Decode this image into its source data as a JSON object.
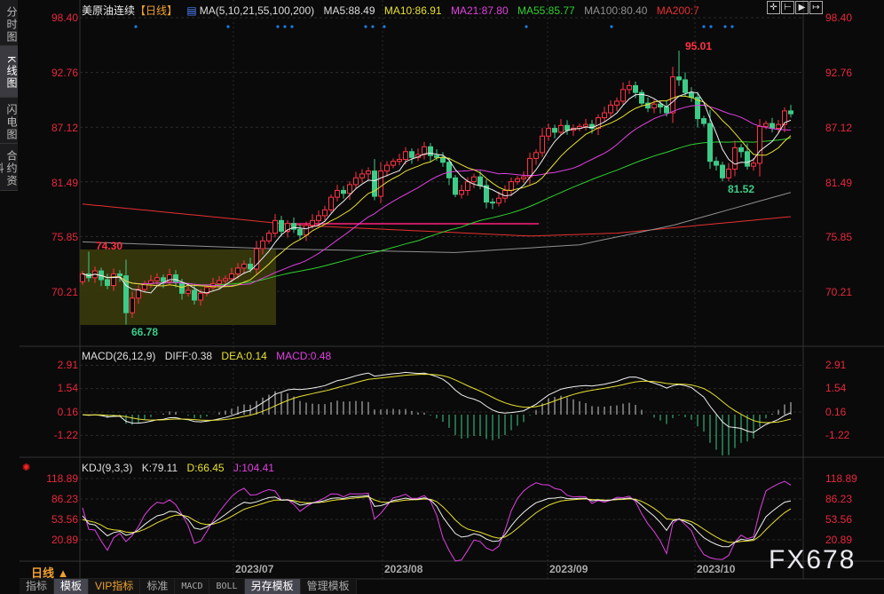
{
  "sidebar": {
    "items": [
      {
        "label": "分时图",
        "selected": false
      },
      {
        "label": "K线图",
        "selected": true
      },
      {
        "label": "闪电图",
        "selected": false
      },
      {
        "label": "合约资料",
        "selected": false
      }
    ]
  },
  "header": {
    "title": "美原油连续",
    "period_tag": "【日线】",
    "ma_params": "MA(5,10,21,55,100,200)",
    "ma5": "MA5:88.49",
    "ma10": "MA10:86.91",
    "ma21": "MA21:87.80",
    "ma55": "MA55:85.77",
    "ma100": "MA100:80.40",
    "ma200": "MA200:7"
  },
  "toolbar": {
    "icons": [
      "crosshair-icon",
      "zoom-range-icon",
      "play-forward-icon",
      "move-right-icon"
    ]
  },
  "colors": {
    "up": "#ff3344",
    "down": "#3dcc88",
    "ma5": "#f0f0f0",
    "ma10": "#e8e030",
    "ma21": "#e040e0",
    "ma55": "#30d030",
    "ma100": "#909090",
    "ma200": "#e83030",
    "hline": "#ff2080",
    "box": "#3a3a0c"
  },
  "main_axis": {
    "labels": [
      "98.40",
      "92.76",
      "87.12",
      "81.49",
      "75.85",
      "70.21"
    ],
    "values": [
      98.4,
      92.76,
      87.12,
      81.49,
      75.85,
      70.21
    ]
  },
  "annotations": {
    "high_left": "74.30",
    "low_left": "66.78",
    "high_right": "95.01",
    "low_right": "81.52"
  },
  "macd": {
    "title": "MACD(26,12,9)",
    "diff": "DIFF:0.38",
    "dea": "DEA:0.14",
    "macd": "MACD:0.48",
    "axis_labels": [
      "2.91",
      "1.54",
      "0.16",
      "-1.22"
    ],
    "axis_values": [
      2.91,
      1.54,
      0.16,
      -1.22
    ]
  },
  "kdj": {
    "title": "KDJ(9,3,3)",
    "k": "K:79.11",
    "d": "D:66.45",
    "j": "J:104.41",
    "axis_labels": [
      "118.89",
      "86.23",
      "53.56",
      "20.89"
    ],
    "axis_values": [
      118.89,
      86.23,
      53.56,
      20.89
    ]
  },
  "dates": [
    "2023/07",
    "2023/08",
    "2023/09",
    "2023/10"
  ],
  "period": "日线 ▲",
  "tabs": [
    {
      "label": "指标"
    },
    {
      "label": "模板",
      "selected": true
    },
    {
      "label": "VIP指标",
      "vip": true
    },
    {
      "label": "标准"
    },
    {
      "label": "MACD"
    },
    {
      "label": "BOLL"
    },
    {
      "label": "另存模板",
      "selected": true
    },
    {
      "label": "管理模板"
    }
  ],
  "watermark": "FX678",
  "chart_data": {
    "type": "candlestick",
    "closes": [
      72.0,
      71.6,
      72.3,
      71.4,
      70.8,
      72.0,
      71.8,
      68.0,
      69.5,
      70.4,
      71.0,
      71.3,
      71.6,
      71.2,
      71.9,
      71.1,
      70.0,
      70.3,
      69.3,
      70.0,
      70.6,
      71.0,
      71.3,
      71.5,
      72.0,
      72.6,
      73.0,
      72.5,
      74.6,
      75.4,
      76.2,
      77.5,
      76.4,
      77.2,
      76.6,
      76.0,
      77.0,
      77.5,
      78.0,
      78.6,
      79.9,
      80.6,
      80.3,
      81.2,
      81.9,
      82.3,
      82.6,
      80.0,
      82.6,
      83.2,
      83.6,
      83.8,
      84.6,
      84.0,
      84.3,
      85.1,
      84.2,
      84.0,
      83.5,
      81.9,
      80.2,
      80.6,
      81.5,
      82.0,
      81.1,
      79.4,
      79.3,
      79.8,
      80.6,
      81.5,
      81.8,
      82.0,
      83.9,
      84.5,
      86.2,
      87.0,
      86.6,
      87.3,
      86.8,
      87.0,
      87.2,
      87.4,
      87.0,
      88.1,
      88.6,
      89.4,
      89.8,
      91.0,
      91.4,
      90.7,
      89.6,
      89.1,
      89.5,
      89.2,
      88.6,
      92.3,
      92.0,
      90.7,
      90.2,
      88.0,
      87.5,
      83.6,
      83.2,
      81.9,
      82.8,
      85.0,
      84.6,
      83.1,
      83.4,
      87.2,
      87.5,
      87.0,
      87.4,
      88.8,
      88.5
    ],
    "ma100_path": [
      [
        0,
        75.3
      ],
      [
        30,
        74.6
      ],
      [
        60,
        74.2
      ],
      [
        80,
        75.0
      ],
      [
        95,
        77.0
      ],
      [
        114,
        80.4
      ]
    ],
    "ma200_path": [
      [
        0,
        79.2
      ],
      [
        35,
        77.0
      ],
      [
        72,
        75.9
      ],
      [
        86,
        76.2
      ],
      [
        114,
        77.9
      ]
    ],
    "ylim": [
      66,
      99
    ]
  }
}
